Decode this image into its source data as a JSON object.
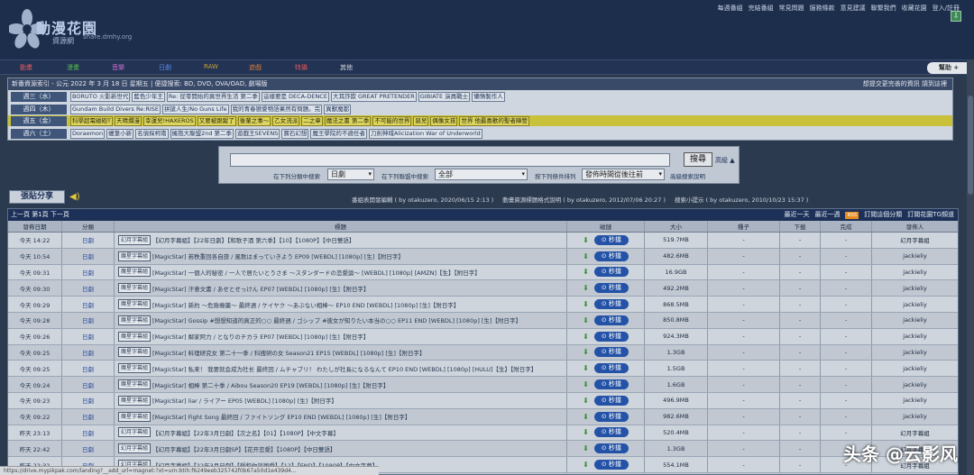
{
  "header": {
    "logo_title": "動漫花園",
    "logo_sub": "資源網",
    "logo_url": "share.dmhy.org",
    "links": [
      "每週番組",
      "完結番組",
      "常見問題",
      "服務條款",
      "意見建議",
      "聯繫我們",
      "收藏花園",
      "登入/註冊"
    ]
  },
  "nav": {
    "items": [
      {
        "label": "動畫",
        "color": "#e35a5a"
      },
      {
        "label": "漫畫",
        "color": "#53b553"
      },
      {
        "label": "音樂",
        "color": "#d26fd2"
      },
      {
        "label": "日劇",
        "color": "#5a8ae8"
      },
      {
        "label": "RAW",
        "color": "#c2a335"
      },
      {
        "label": "遊戲",
        "color": "#d27a3a"
      },
      {
        "label": "特攝",
        "color": "#d9565f"
      },
      {
        "label": "其他",
        "color": "#d9dde5"
      }
    ],
    "help": "幫助"
  },
  "schedule": {
    "header": "新番資源索引 - 公元 2022 年 3 月 18 日 星期五 | 便捷搜索: BD, DVD, OVA/OAD, 劇場版",
    "header_right": "想提交更完善的資訊 請到這裡",
    "rows": [
      {
        "day": "週三（水）",
        "shows": [
          "BORUTO 火影新世代",
          "藍色少年王",
          "Re: 從零開始的異世界生活 第二季",
          "這樣要是 DECA-DENCE",
          "大耳詐欺 GREAT PRETENDER",
          "GIBIATE 演員戰士",
          "懶惰製作人"
        ]
      },
      {
        "day": "週四（木）",
        "shows": [
          "Gundam Build Divers Re:RISE",
          "拼搶人生/No Guns Life",
          "我的青春戀愛物語果然有問題。完",
          "異獸魔都"
        ]
      },
      {
        "day": "週五（金）",
        "shows": [
          "科學超電磁砲T",
          "天晴爛漫",
          "幸運兒!HAXEROS",
          "又要被跟蹤了",
          "後輩之事～",
          "乙女流派",
          "二之章",
          "魔法之書 第二季",
          "不可能的世界",
          "惡兒",
          "偶像女孩",
          "世界 他最喜歡的聖者陣營"
        ]
      },
      {
        "day": "週六（土）",
        "shows": [
          "Doraemon",
          "蠟筆小新",
          "名偵探柯南",
          "擁抱大聯盟2nd 第二季",
          "遊戲王SEVENS",
          "寶石幻想",
          "魔王學院的不適任者",
          "刀劍神域Alicization War of Underworld"
        ]
      }
    ]
  },
  "search": {
    "query": "",
    "button": "搜尋",
    "advanced": "高級 ▲",
    "label1": "在下列分類中搜索",
    "select1": "日劇",
    "label2": "在下列聯盟中搜索",
    "select2": "全部",
    "label3": "按下列條件排列",
    "select3": "發佈時間從後往前",
    "help": "高級搜索說明"
  },
  "paste": {
    "label": "張貼分享"
  },
  "notices": [
    "番組表開發編輯 ( by otakuzero, 2020/06/15 2:13 )",
    "動畫資源標題格式說明 ( by otakuzero, 2012/07/06 20:27 )",
    "搜索小提示 ( by otakuzero, 2010/10/23 15:37 )"
  ],
  "table": {
    "pager": "上一頁 第1頁 下一頁",
    "right_links": [
      "最近一天",
      "最近一週"
    ],
    "rss": "RSS",
    "subscribe": "訂閱這個分類",
    "subscribe_tg": "訂閱花園TG頻道",
    "columns": [
      "發佈日期",
      "分類",
      "標題",
      "磁鏈",
      "大小",
      "種子",
      "下載",
      "完成",
      "發佈人"
    ],
    "magnet_label": "⊙ 秒擋",
    "rows": [
      {
        "date": "今天 14:22",
        "cat": "日劇",
        "group": "幻月字幕組",
        "title": "【幻月字幕組】【22年日劇】【和歌子酒 第六季】【10】【1080P】【中日雙語】",
        "size": "519.7MB",
        "seed": "-",
        "dl": "-",
        "done": "-",
        "pub": "幻月字幕組"
      },
      {
        "date": "今天 10:54",
        "cat": "日劇",
        "group": "魔星字幕組",
        "title": "[MagicStar] 若秩重回各自旅 / 風歌はまっていきよう EP09 [WEBDL] [1080p] [生]【附日字】",
        "size": "482.6MB",
        "seed": "-",
        "dl": "-",
        "done": "-",
        "pub": "jackieliy"
      },
      {
        "date": "今天 09:31",
        "cat": "日劇",
        "group": "魔星字幕組",
        "title": "[MagicStar] 一個人的秘密 / 一人で居たいとうさま ～スタンダードの恋愛論～ [WEBDL] [1080p] [AMZN]【生】【附日字】",
        "size": "16.9GB",
        "seed": "-",
        "dl": "-",
        "done": "-",
        "pub": "jackieliy"
      },
      {
        "date": "今天 09:30",
        "cat": "日劇",
        "group": "魔星字幕組",
        "title": "[MagicStar] 汗意文書 / あせとせっけん EP07 [WEBDL] [1080p] [生]【附日字】",
        "size": "492.2MB",
        "seed": "-",
        "dl": "-",
        "done": "-",
        "pub": "jackieliy"
      },
      {
        "date": "今天 09:29",
        "cat": "日劇",
        "group": "魔星字幕組",
        "title": "[MagicStar] 新約 ～危險瘾藥～ 最終週 / ケイヤク ～あぶない相棒～ EP10 END [WEBDL] [1080p] [生]【附日字】",
        "size": "868.5MB",
        "seed": "-",
        "dl": "-",
        "done": "-",
        "pub": "jackieliy"
      },
      {
        "date": "今天 09:28",
        "cat": "日劇",
        "group": "魔星字幕組",
        "title": "[MagicStar] Gossip #想想知道的真正的○○ 最終週 / ゴシップ #彼女が知りたい本当の○○ EP11 END [WEBDL] [1080p] [生]【附日字】",
        "size": "850.8MB",
        "seed": "-",
        "dl": "-",
        "done": "-",
        "pub": "jackieliy"
      },
      {
        "date": "今天 09:26",
        "cat": "日劇",
        "group": "魔星字幕組",
        "title": "[MagicStar] 鄰家阿力 / となりのチカラ EP07 [WEBDL] [1080p] [生]【附日字】",
        "size": "924.3MB",
        "seed": "-",
        "dl": "-",
        "done": "-",
        "pub": "jackieliy"
      },
      {
        "date": "今天 09:25",
        "cat": "日劇",
        "group": "魔星字幕組",
        "title": "[MagicStar] 料理研究女 第二十一季 / 科捜研の女 Season21 EP15 [WEBDL] [1080p] [生]【附日字】",
        "size": "1.3GB",
        "seed": "-",
        "dl": "-",
        "done": "-",
        "pub": "jackieliy"
      },
      {
        "date": "今天 09:25",
        "cat": "日劇",
        "group": "魔星字幕組",
        "title": "[MagicStar] 私来！ 我要就会成为社长 最终回 / ムチャブリ！ わたしが社長になるなんて EP10 END [WEBDL] [1080p] [HULU]【生】【附日字】",
        "size": "1.5GB",
        "seed": "-",
        "dl": "-",
        "done": "-",
        "pub": "jackieliy"
      },
      {
        "date": "今天 09:24",
        "cat": "日劇",
        "group": "魔星字幕組",
        "title": "[MagicStar] 相棒 第二十季 / Aibou Season20 EP19 [WEBDL] [1080p] [生]【附日字】",
        "size": "1.6GB",
        "seed": "-",
        "dl": "-",
        "done": "-",
        "pub": "jackieliy"
      },
      {
        "date": "今天 09:23",
        "cat": "日劇",
        "group": "魔星字幕組",
        "title": "[MagicStar] liar / ライアー EP05 [WEBDL] [1080p] [生]【附日字】",
        "size": "496.9MB",
        "seed": "-",
        "dl": "-",
        "done": "-",
        "pub": "jackieliy"
      },
      {
        "date": "今天 09:22",
        "cat": "日劇",
        "group": "魔星字幕組",
        "title": "[MagicStar] Fight Song 最終回 / ファイトソング EP10 END [WEBDL] [1080p] [生]【附日字】",
        "size": "982.6MB",
        "seed": "-",
        "dl": "-",
        "done": "-",
        "pub": "jackieliy"
      },
      {
        "date": "昨天 23:13",
        "cat": "日劇",
        "group": "幻月字幕組",
        "title": "【幻月字幕組】【22年3月日劇】【次之名】【01】【1080P】【中文字幕】",
        "size": "520.4MB",
        "seed": "-",
        "dl": "-",
        "done": "-",
        "pub": "幻月字幕組"
      },
      {
        "date": "昨天 22:42",
        "cat": "日劇",
        "group": "幻月字幕組",
        "title": "【幻月字幕組】【22年3月日劇SP】【花开恋愛】【1080P】【中日雙語】",
        "size": "1.3GB",
        "seed": "-",
        "dl": "-",
        "done": "-",
        "pub": "幻月字幕組"
      },
      {
        "date": "昨天 22:32",
        "cat": "日劇",
        "group": "幻月字幕組",
        "title": "【幻月字幕組】【22年3月日劇】【想和你談戀愛】【12】【END】【1080P】【中文字幕】",
        "size": "554.1MB",
        "seed": "-",
        "dl": "-",
        "done": "-",
        "pub": "幻月字幕組"
      }
    ]
  },
  "status": "https://drive.mypikpak.com/landing?__add_url=magnet:?xt=urn:btih:f6249eeb325742f0b67a50d1e439d4...",
  "watermark": "头条 @云影风"
}
